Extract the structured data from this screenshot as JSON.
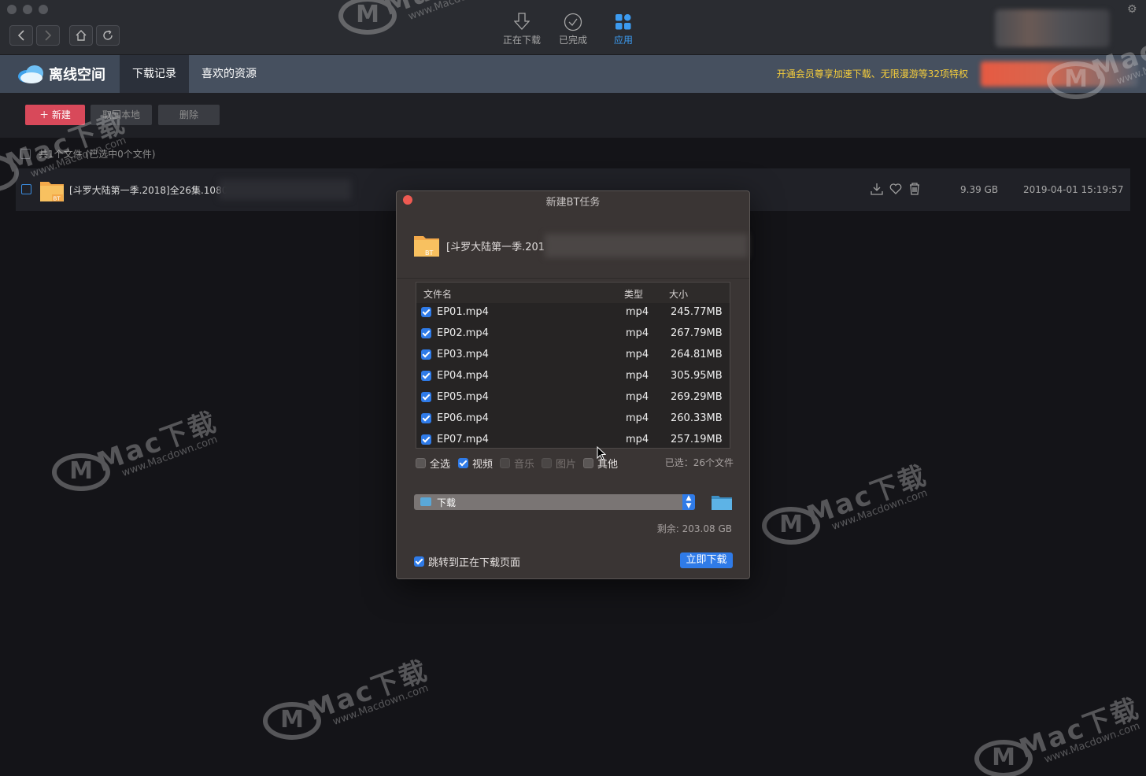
{
  "toolbar_tabs": [
    {
      "label": "正在下载",
      "icon": "download-arrow-icon",
      "active": false
    },
    {
      "label": "已完成",
      "icon": "check-circle-icon",
      "active": false
    },
    {
      "label": "应用",
      "icon": "apps-grid-icon",
      "active": true
    }
  ],
  "header": {
    "brand": "离线空间",
    "tabs": [
      "下载记录",
      "喜欢的资源"
    ],
    "active_tab": 0,
    "promo": "开通会员尊享加速下载、无限漫游等32项特权"
  },
  "actions": {
    "new_label": "新建",
    "local_label": "取回本地",
    "delete_label": "删除"
  },
  "list": {
    "summary": "共1个文件 (已选中0个文件)",
    "files": [
      {
        "name": "[斗罗大陆第一季.2018]全26集.1080",
        "size": "9.39 GB",
        "date": "2019-04-01 15:19:57",
        "badge": "BT"
      }
    ]
  },
  "dialog": {
    "title": "新建BT任务",
    "task_name": "[斗罗大陆第一季.201",
    "columns": {
      "name": "文件名",
      "type": "类型",
      "size": "大小"
    },
    "files": [
      {
        "name": "EP01.mp4",
        "type": "mp4",
        "size": "245.77MB"
      },
      {
        "name": "EP02.mp4",
        "type": "mp4",
        "size": "267.79MB"
      },
      {
        "name": "EP03.mp4",
        "type": "mp4",
        "size": "264.81MB"
      },
      {
        "name": "EP04.mp4",
        "type": "mp4",
        "size": "305.95MB"
      },
      {
        "name": "EP05.mp4",
        "type": "mp4",
        "size": "269.29MB"
      },
      {
        "name": "EP06.mp4",
        "type": "mp4",
        "size": "260.33MB"
      },
      {
        "name": "EP07.mp4",
        "type": "mp4",
        "size": "257.19MB"
      }
    ],
    "filters": {
      "all": "全选",
      "video": "视频",
      "music": "音乐",
      "image": "图片",
      "other": "其他"
    },
    "selected": "已选：26个文件",
    "path": "下载",
    "free_space": "剩余: 203.08 GB",
    "jump_label": "跳转到正在下载页面",
    "download_label": "立即下载"
  },
  "watermark": {
    "text": "Mac下载",
    "url": "www.Macdown.com"
  },
  "colors": {
    "accent": "#2f7be8",
    "new_button": "#d8495a",
    "promo": "#f4cd3c",
    "header": "#46505f"
  }
}
